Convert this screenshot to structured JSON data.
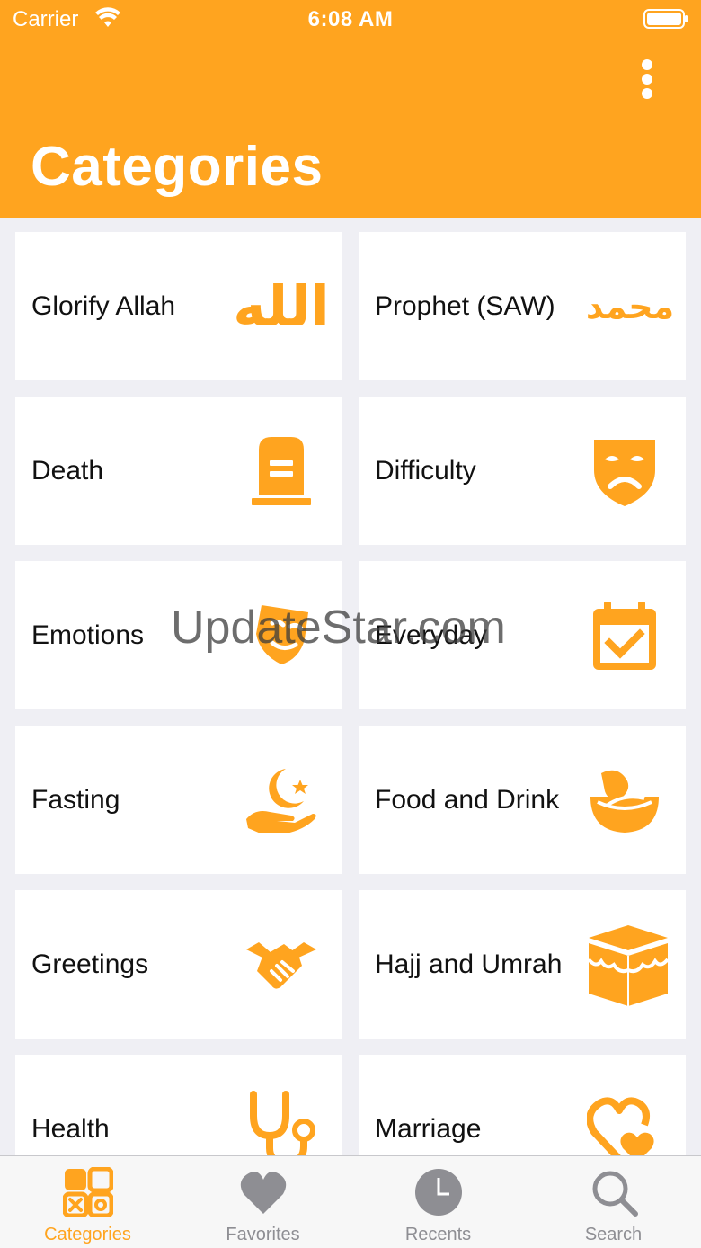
{
  "status_bar": {
    "carrier": "Carrier",
    "time": "6:08 AM"
  },
  "header": {
    "title": "Categories"
  },
  "categories": [
    {
      "label": "Glorify Allah",
      "icon": "allah-calligraphy-icon",
      "glyph": "الله"
    },
    {
      "label": "Prophet (SAW)",
      "icon": "muhammad-calligraphy-icon",
      "glyph": "محمد"
    },
    {
      "label": "Death",
      "icon": "gravestone-icon"
    },
    {
      "label": "Difficulty",
      "icon": "sad-mask-icon"
    },
    {
      "label": "Emotions",
      "icon": "masks-icon"
    },
    {
      "label": "Everyday",
      "icon": "calendar-check-icon"
    },
    {
      "label": "Fasting",
      "icon": "crescent-hand-icon"
    },
    {
      "label": "Food and Drink",
      "icon": "food-bowl-icon"
    },
    {
      "label": "Greetings",
      "icon": "handshake-icon"
    },
    {
      "label": "Hajj and Umrah",
      "icon": "kaaba-icon"
    },
    {
      "label": "Health",
      "icon": "stethoscope-icon"
    },
    {
      "label": "Marriage",
      "icon": "hearts-icon"
    }
  ],
  "watermark": "UpdateStar.com",
  "tabbar": {
    "tabs": [
      {
        "label": "Categories",
        "icon": "categories-grid-icon",
        "active": true
      },
      {
        "label": "Favorites",
        "icon": "heart-icon",
        "active": false
      },
      {
        "label": "Recents",
        "icon": "clock-icon",
        "active": false
      },
      {
        "label": "Search",
        "icon": "search-icon",
        "active": false
      }
    ]
  },
  "colors": {
    "accent": "#ffa41f",
    "background": "#efeff4",
    "tile": "#ffffff",
    "inactive": "#8e8e93"
  }
}
